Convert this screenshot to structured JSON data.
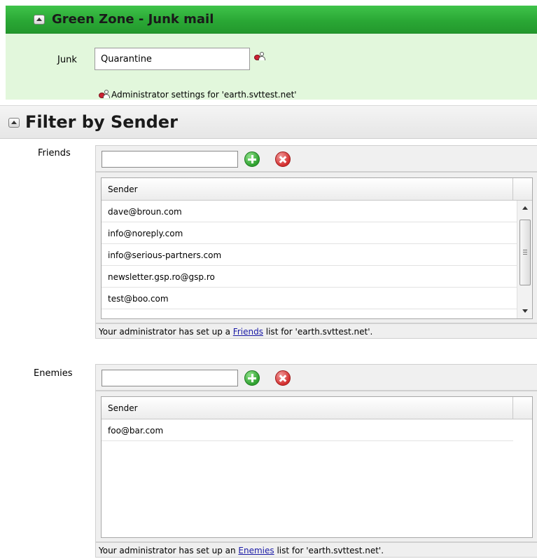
{
  "green_zone": {
    "title": "Green Zone - Junk mail",
    "junk_label": "Junk",
    "junk_value": "Quarantine",
    "admin_note": "Administrator settings for 'earth.svttest.net'"
  },
  "filter": {
    "title": "Filter by Sender",
    "friends": {
      "label": "Friends",
      "input_value": "",
      "column_header": "Sender",
      "rows": [
        "dave@broun.com",
        "info@noreply.com",
        "info@serious-partners.com",
        "newsletter.gsp.ro@gsp.ro",
        "test@boo.com"
      ],
      "note_prefix": "Your administrator has set up a ",
      "note_link": "Friends",
      "note_suffix": " list for 'earth.svttest.net'."
    },
    "enemies": {
      "label": "Enemies",
      "input_value": "",
      "column_header": "Sender",
      "rows": [
        "foo@bar.com"
      ],
      "note_prefix": "Your administrator has set up an ",
      "note_link": "Enemies",
      "note_suffix": " list for 'earth.svttest.net'."
    }
  },
  "icons": {
    "collapse": "collapse-up-icon",
    "admin": "admin-lock-icon",
    "add": "add-circle-icon",
    "remove": "remove-circle-icon"
  },
  "colors": {
    "green_header": "#2aa835",
    "green_panel": "#e2f7dc",
    "add_button": "#2ea02f",
    "remove_button": "#d32f2f",
    "link": "#1a1aa6"
  }
}
